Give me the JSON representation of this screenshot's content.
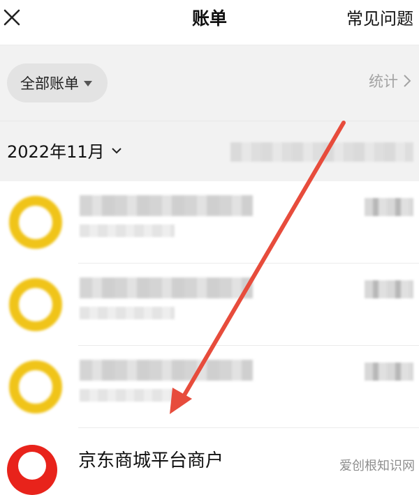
{
  "header": {
    "title": "账单",
    "faq_label": "常见问题"
  },
  "filter": {
    "selected": "全部账单",
    "stats_label": "统计"
  },
  "month": {
    "label": "2022年11月",
    "summary": ""
  },
  "transactions": [
    {
      "title": "",
      "subtitle": "",
      "amount": ""
    },
    {
      "title": "",
      "subtitle": "",
      "amount": ""
    },
    {
      "title": "",
      "subtitle": "",
      "amount": ""
    }
  ],
  "merchant": {
    "name": "京东商城平台商户"
  },
  "watermark": "爱创根知识网",
  "colors": {
    "accent_yellow": "#f0c419",
    "arrow_red": "#e74c3c",
    "merchant_red": "#e8231b"
  },
  "icons": {
    "close": "close-icon",
    "dropdown": "caret-down-icon",
    "stats": "chevron-right-icon",
    "month": "chevron-down-icon"
  }
}
